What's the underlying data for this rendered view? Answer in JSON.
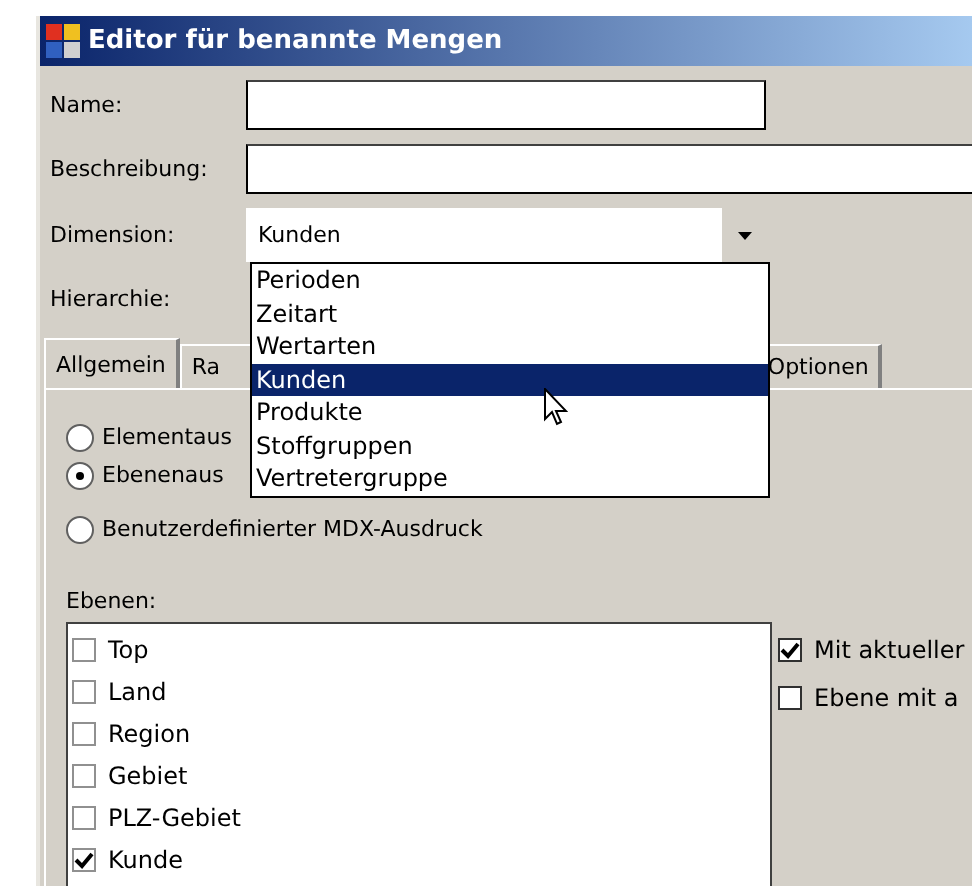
{
  "window": {
    "title": "Editor für benannte Mengen"
  },
  "fields": [
    {
      "label": "Name:",
      "kind": "text"
    },
    {
      "label": "Beschreibung:",
      "kind": "text"
    },
    {
      "label": "Dimension:",
      "kind": "combo",
      "value": "Kunden"
    },
    {
      "label": "Hierarchie:",
      "kind": "hidden"
    }
  ],
  "dropdown": {
    "items": [
      {
        "label": "Perioden",
        "selected": false
      },
      {
        "label": "Zeitart",
        "selected": false
      },
      {
        "label": "Wertarten",
        "selected": false
      },
      {
        "label": "Kunden",
        "selected": true
      },
      {
        "label": "Produkte",
        "selected": false
      },
      {
        "label": "Stoffgruppen",
        "selected": false
      },
      {
        "label": "Vertretergruppe",
        "selected": false
      }
    ]
  },
  "tabs": [
    {
      "label": "Allgemein",
      "selected": true
    },
    {
      "label": "Ra",
      "selected": false
    },
    {
      "label": "Optionen",
      "selected": false
    }
  ],
  "radios": [
    {
      "label": "Elementaus",
      "selected": false
    },
    {
      "label": "Ebenenaus",
      "selected": true
    },
    {
      "label": "Benutzerdefinierter MDX-Ausdruck",
      "selected": false
    }
  ],
  "levels": {
    "label": "Ebenen:",
    "items": [
      {
        "label": "Top",
        "checked": false
      },
      {
        "label": "Land",
        "checked": false
      },
      {
        "label": "Region",
        "checked": false
      },
      {
        "label": "Gebiet",
        "checked": false
      },
      {
        "label": "PLZ-Gebiet",
        "checked": false
      },
      {
        "label": "Kunde",
        "checked": true
      }
    ]
  },
  "options": [
    {
      "label": "Mit aktueller",
      "checked": true
    },
    {
      "label": "Ebene mit a",
      "checked": false
    }
  ]
}
